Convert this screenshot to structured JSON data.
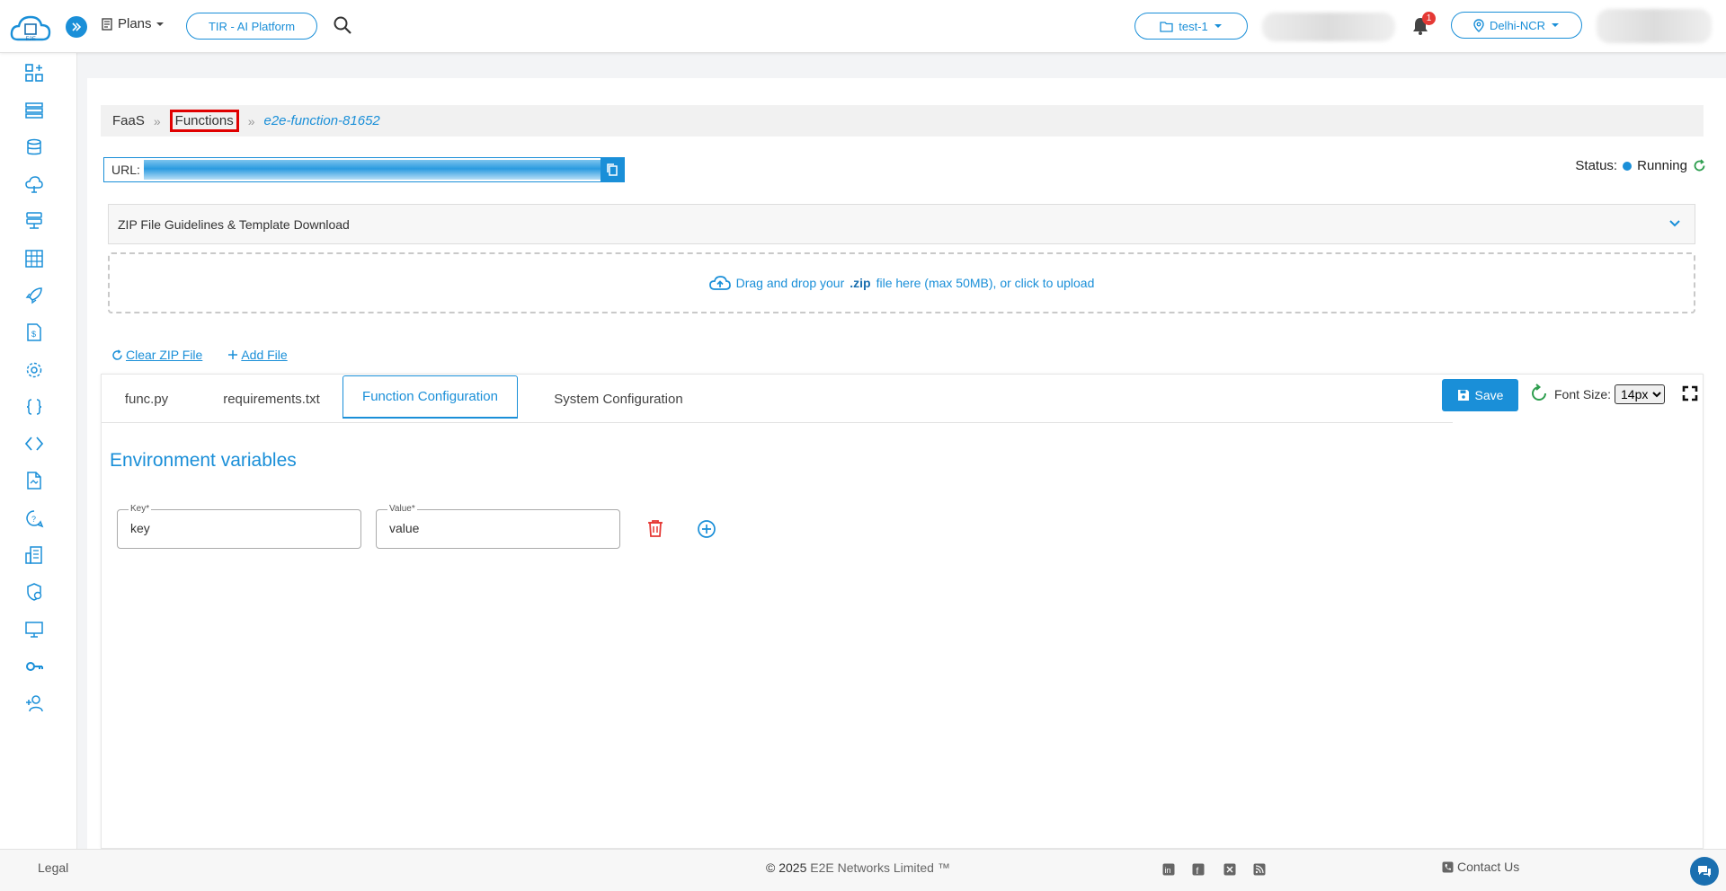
{
  "header": {
    "logo_label": "E2E",
    "plans_label": "Plans",
    "platform_label": "TIR - AI Platform",
    "project_label": "test-1",
    "notification_count": "1",
    "region_label": "Delhi-NCR"
  },
  "sidebar": {
    "icons": [
      "dashboard-icon",
      "nodes-icon",
      "database-icon",
      "cloud-upload-icon",
      "storage-icon",
      "table-grid-icon",
      "rocket-icon",
      "billing-icon",
      "gear-icon",
      "curly-braces-icon",
      "code-icon",
      "document-icon",
      "chat-help-icon",
      "building-icon",
      "shield-user-icon",
      "monitor-icon",
      "key-icon",
      "add-user-icon"
    ]
  },
  "breadcrumb": {
    "items": [
      "FaaS",
      "Functions"
    ],
    "current": "e2e-function-81652",
    "separator": "»"
  },
  "url_box": {
    "label": "URL:"
  },
  "status": {
    "label": "Status:",
    "value": "Running",
    "color": "#1a8fd8"
  },
  "accordion": {
    "title": "ZIP File Guidelines & Template Download"
  },
  "dropzone": {
    "text_before": "Drag and drop your",
    "ext": ".zip",
    "text_after": "file here (max 50MB), or click to upload"
  },
  "file_actions": {
    "clear": "Clear ZIP File",
    "add": "Add File"
  },
  "editor": {
    "tabs": [
      "func.py",
      "requirements.txt",
      "Function Configuration",
      "System Configuration"
    ],
    "active_tab": "Function Configuration",
    "save_label": "Save",
    "font_size_label": "Font Size:",
    "font_size_value": "14px",
    "font_size_options": [
      "14px"
    ]
  },
  "env": {
    "title": "Environment variables",
    "key_label": "Key",
    "key_value": "key",
    "value_label": "Value",
    "value_value": "value",
    "required_mark": "*"
  },
  "footer": {
    "legal": "Legal",
    "copyright_year": "© 2025",
    "copyright_org": "E2E Networks Limited ™",
    "social_icons": [
      "linkedin-icon",
      "facebook-icon",
      "x-twitter-icon",
      "rss-icon"
    ],
    "contact": "Contact Us"
  },
  "colors": {
    "accent": "#1a8fd8",
    "highlight_box": "#e00000",
    "danger": "#e53935"
  }
}
